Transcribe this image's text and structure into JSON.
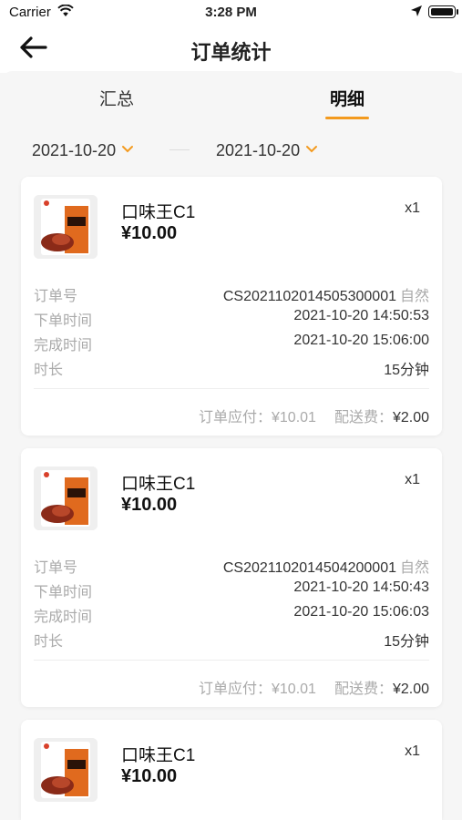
{
  "status_bar": {
    "carrier": "Carrier",
    "time": "3:28 PM"
  },
  "nav": {
    "title": "订单统计"
  },
  "tabs": [
    {
      "label": "汇总"
    },
    {
      "label": "明细",
      "active": true
    }
  ],
  "filter": {
    "start_date": "2021-10-20",
    "end_date": "2021-10-20"
  },
  "labels": {
    "order_no": "订单号",
    "order_time": "下单时间",
    "complete_time": "完成时间",
    "duration": "时长",
    "payable": "订单应付：",
    "delivery_fee": "配送费："
  },
  "orders": [
    {
      "product_name": "口味王C1",
      "price": "¥10.00",
      "qty": "x1",
      "order_no": "CS20211020145053000​01",
      "order_type": "自然",
      "order_time": "2021-10-20 14:50:53",
      "complete_time": "2021-10-20 15:06:00",
      "duration": "15分钟",
      "payable": "¥10.01",
      "delivery_fee": "¥2.00"
    },
    {
      "product_name": "口味王C1",
      "price": "¥10.00",
      "qty": "x1",
      "order_no": "CS2021102014504200001",
      "order_type": "自然",
      "order_time": "2021-10-20 14:50:43",
      "complete_time": "2021-10-20 15:06:03",
      "duration": "15分钟",
      "payable": "¥10.01",
      "delivery_fee": "¥2.00"
    },
    {
      "product_name": "口味王C1",
      "price": "¥10.00",
      "qty": "x1"
    }
  ],
  "colors": {
    "accent": "#f39a1e",
    "background": "#f6f6f6",
    "card": "#ffffff",
    "muted": "#aaaaaa"
  },
  "icons": {
    "back": "arrow-left-icon",
    "dropdown": "chevron-down-icon",
    "wifi": "wifi-icon",
    "location": "location-arrow-icon",
    "battery": "battery-icon"
  }
}
